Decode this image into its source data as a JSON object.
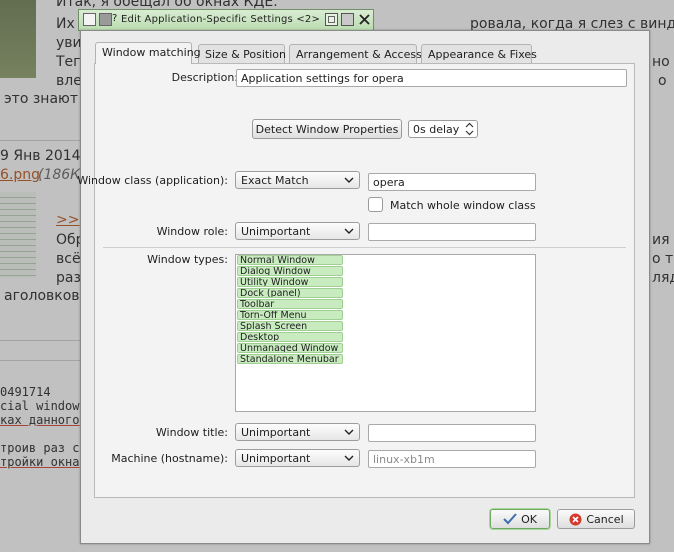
{
  "background": {
    "lines": [
      "Итак, я обещал об окнах КДЕ.",
      "Их",
      "ровала, когда я слез с винды",
      "уви",
      "Тег",
      "вле",
      "это знают",
      "9 Янв 2014",
      "6.png",
      "(186К",
      ">>",
      "Обр",
      "всё",
      "раз",
      "аголовков с",
      "0491714",
      "cial window",
      "ках данного",
      "трoив раз с",
      "тройки окна",
      "но",
      "о",
      "ия с",
      "о тя",
      "ляд,"
    ]
  },
  "window": {
    "title": "Edit Application-Specific Settings <2>",
    "accent": "#bcdcb1"
  },
  "tabs": [
    {
      "label": "Window matching",
      "active": true
    },
    {
      "label": "Size & Position",
      "active": false
    },
    {
      "label": "Arrangement & Access",
      "active": false
    },
    {
      "label": "Appearance & Fixes",
      "active": false
    }
  ],
  "form": {
    "description_label": "Description:",
    "description_value": "Application settings for opera",
    "detect_button": "Detect Window Properties",
    "delay_value": "0s delay",
    "window_class_label": "Window class (application):",
    "window_class_match": "Exact Match",
    "window_class_value": "opera",
    "match_whole_label": "Match whole window class",
    "match_whole_checked": false,
    "window_role_label": "Window role:",
    "window_role_match": "Unimportant",
    "window_role_value": "",
    "window_types_label": "Window types:",
    "window_types": [
      "Normal Window",
      "Dialog Window",
      "Utility Window",
      "Dock (panel)",
      "Toolbar",
      "Torn-Off Menu",
      "Splash Screen",
      "Desktop",
      "Unmanaged Window",
      "Standalone Menubar"
    ],
    "window_title_label": "Window title:",
    "window_title_match": "Unimportant",
    "window_title_value": "",
    "machine_label": "Machine (hostname):",
    "machine_match": "Unimportant",
    "machine_placeholder": "linux-xb1m"
  },
  "buttons": {
    "ok": "OK",
    "cancel": "Cancel"
  }
}
